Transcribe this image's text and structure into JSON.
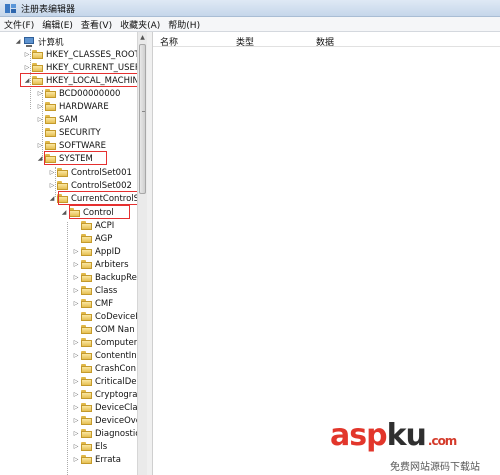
{
  "window": {
    "title": "注册表编辑器"
  },
  "menu": [
    "文件(F)",
    "编辑(E)",
    "查看(V)",
    "收藏夹(A)",
    "帮助(H)"
  ],
  "columns": {
    "name": "名称",
    "type": "类型",
    "data": "数据"
  },
  "tree": {
    "root": "计算机",
    "hives": [
      "HKEY_CLASSES_ROOT",
      "HKEY_CURRENT_USER",
      "HKEY_LOCAL_MACHINE"
    ],
    "hklm_children": [
      "BCD00000000",
      "HARDWARE",
      "SAM",
      "SECURITY",
      "SOFTWARE",
      "SYSTEM"
    ],
    "system_children": [
      "ControlSet001",
      "ControlSet002",
      "CurrentControlSe"
    ],
    "ccs_children": [
      "Control"
    ],
    "control_children": [
      "ACPI",
      "AGP",
      "AppID",
      "Arbiters",
      "BackupRe",
      "Class",
      "CMF",
      "CoDeviceI",
      "COM Nan",
      "Computer",
      "ContentIn",
      "CrashCon",
      "CriticalDe",
      "Cryptogra",
      "DeviceCla",
      "DeviceOve",
      "Diagnostic",
      "Els",
      "Errata"
    ]
  },
  "watermark": {
    "brand_a": "asp",
    "brand_b": "ku",
    "tld": ".com",
    "sub": "免费网站源码下载站"
  }
}
